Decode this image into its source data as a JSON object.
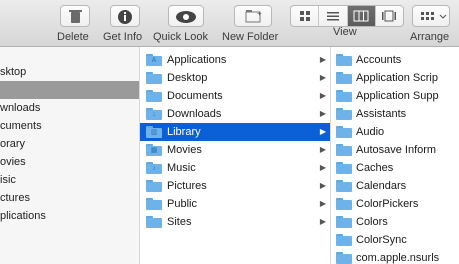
{
  "toolbar": {
    "delete_label": "Delete",
    "getinfo_label": "Get Info",
    "quicklook_label": "Quick Look",
    "newfolder_label": "New Folder",
    "view_label": "View",
    "arrange_label": "Arrange"
  },
  "sidebar": {
    "items": [
      "sktop",
      "",
      "wnloads",
      "cuments",
      "orary",
      "ovies",
      "isic",
      "ctures",
      "plications"
    ]
  },
  "column2": {
    "items": [
      {
        "label": "Applications",
        "icon": "applications-folder-icon"
      },
      {
        "label": "Desktop",
        "icon": "desktop-folder-icon"
      },
      {
        "label": "Documents",
        "icon": "documents-folder-icon"
      },
      {
        "label": "Downloads",
        "icon": "downloads-folder-icon"
      },
      {
        "label": "Library",
        "icon": "library-folder-icon",
        "selected": true
      },
      {
        "label": "Movies",
        "icon": "movies-folder-icon"
      },
      {
        "label": "Music",
        "icon": "music-folder-icon"
      },
      {
        "label": "Pictures",
        "icon": "pictures-folder-icon"
      },
      {
        "label": "Public",
        "icon": "public-folder-icon"
      },
      {
        "label": "Sites",
        "icon": "sites-folder-icon"
      }
    ]
  },
  "column3": {
    "items": [
      "Accounts",
      "Application Scrip",
      "Application Supp",
      "Assistants",
      "Audio",
      "Autosave Inform",
      "Caches",
      "Calendars",
      "ColorPickers",
      "Colors",
      "ColorSync",
      "com.apple.nsurls"
    ]
  },
  "colors": {
    "selection": "#0b60d8",
    "folder": "#6db3ea"
  }
}
